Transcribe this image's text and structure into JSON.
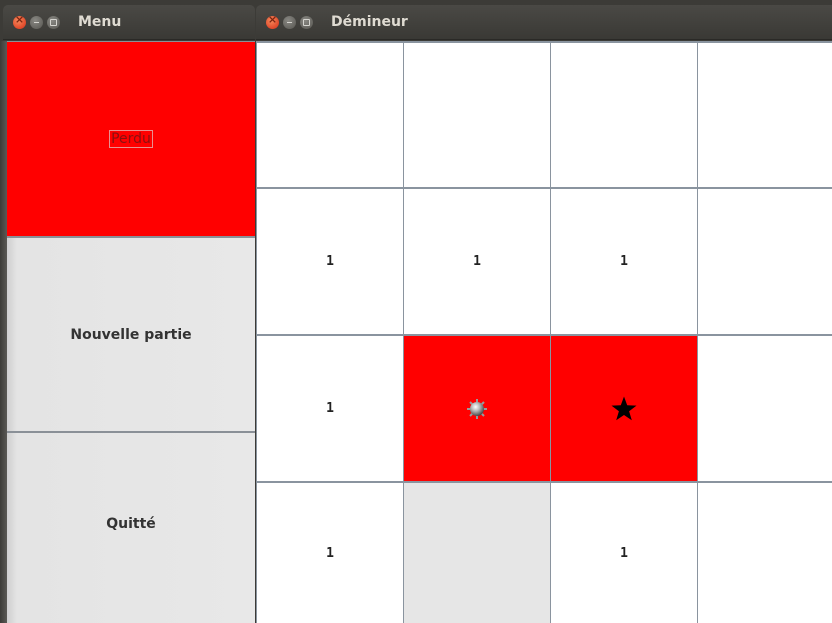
{
  "menu_window": {
    "title": "Menu",
    "status": "Perdu",
    "new_game_label": "Nouvelle partie",
    "quit_label": "Quitté"
  },
  "game_window": {
    "title": "Démineur"
  },
  "grid": {
    "rows": [
      [
        {
          "state": "revealed",
          "text": ""
        },
        {
          "state": "revealed",
          "text": ""
        },
        {
          "state": "revealed",
          "text": ""
        },
        {
          "state": "revealed",
          "text": ""
        }
      ],
      [
        {
          "state": "revealed",
          "text": "1"
        },
        {
          "state": "revealed",
          "text": "1"
        },
        {
          "state": "revealed",
          "text": "1"
        },
        {
          "state": "revealed",
          "text": ""
        }
      ],
      [
        {
          "state": "revealed",
          "text": "1"
        },
        {
          "state": "exploded",
          "icon": "mine-icon"
        },
        {
          "state": "exploded",
          "icon": "star-icon"
        },
        {
          "state": "revealed",
          "text": ""
        }
      ],
      [
        {
          "state": "revealed",
          "text": "1"
        },
        {
          "state": "unrevealed",
          "text": ""
        },
        {
          "state": "revealed",
          "text": "1"
        },
        {
          "state": "revealed",
          "text": ""
        }
      ]
    ]
  },
  "colors": {
    "loss_red": "#ff0000",
    "grid_line": "#8a949f",
    "cell_revealed": "#ffffff",
    "cell_unrevealed": "#e6e6e6"
  }
}
